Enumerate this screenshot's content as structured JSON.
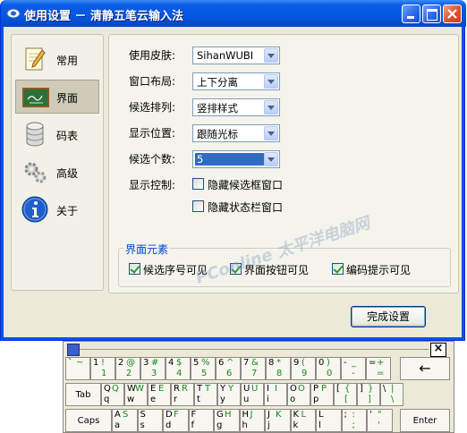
{
  "window": {
    "title": "使用设置 － 清静五笔云输入法"
  },
  "sidebar": {
    "items": [
      {
        "label": "常用",
        "icon": "notepad-pencil-icon"
      },
      {
        "label": "界面",
        "icon": "chalkboard-icon"
      },
      {
        "label": "码表",
        "icon": "database-icon"
      },
      {
        "label": "高级",
        "icon": "gears-icon"
      },
      {
        "label": "关于",
        "icon": "info-icon"
      }
    ],
    "active": "界面"
  },
  "form": {
    "skin_label": "使用皮肤:",
    "skin_value": "SihanWUBI",
    "layout_label": "窗口布局:",
    "layout_value": "上下分离",
    "order_label": "候选排列:",
    "order_value": "竖排样式",
    "position_label": "显示位置:",
    "position_value": "跟随光标",
    "count_label": "候选个数:",
    "count_value": "5",
    "display_label": "显示控制:",
    "hide_candidate_label": "隐藏候选框窗口",
    "hide_candidate_checked": false,
    "hide_status_label": "隐藏状态栏窗口",
    "hide_status_checked": false
  },
  "elements": {
    "group_title": "界面元素",
    "items": [
      {
        "label": "候选序号可见",
        "checked": true
      },
      {
        "label": "界面按钮可见",
        "checked": true
      },
      {
        "label": "编码提示可见",
        "checked": true
      }
    ]
  },
  "watermark": "PConline 太平洋电脑网",
  "ok_button": "完成设置",
  "keyboard": {
    "close": "×",
    "row1": [
      {
        "t": "`",
        "b": "",
        "s1": "~",
        "s2": ""
      },
      {
        "t": "1",
        "b": "",
        "s1": "!",
        "s2": "1"
      },
      {
        "t": "2",
        "b": "",
        "s1": "@",
        "s2": "2"
      },
      {
        "t": "3",
        "b": "",
        "s1": "#",
        "s2": "3"
      },
      {
        "t": "4",
        "b": "",
        "s1": "$",
        "s2": "4"
      },
      {
        "t": "5",
        "b": "",
        "s1": "%",
        "s2": "5"
      },
      {
        "t": "6",
        "b": "",
        "s1": "^",
        "s2": "6"
      },
      {
        "t": "7",
        "b": "",
        "s1": "&",
        "s2": "7"
      },
      {
        "t": "8",
        "b": "",
        "s1": "*",
        "s2": "8"
      },
      {
        "t": "9",
        "b": "",
        "s1": "(",
        "s2": "9"
      },
      {
        "t": "0",
        "b": "",
        "s1": ")",
        "s2": "0"
      },
      {
        "t": "-",
        "b": "",
        "s1": "_",
        "s2": "-"
      },
      {
        "t": "=",
        "b": "",
        "s1": "+",
        "s2": "="
      }
    ],
    "backspace": "←",
    "tab": "Tab",
    "row2": [
      {
        "t": "Q",
        "b": "q",
        "s1": "Q",
        "s2": ""
      },
      {
        "t": "W",
        "b": "w",
        "s1": "W",
        "s2": ""
      },
      {
        "t": "E",
        "b": "e",
        "s1": "E",
        "s2": ""
      },
      {
        "t": "R",
        "b": "r",
        "s1": "R",
        "s2": ""
      },
      {
        "t": "T",
        "b": "t",
        "s1": "T",
        "s2": ""
      },
      {
        "t": "Y",
        "b": "y",
        "s1": "Y",
        "s2": ""
      },
      {
        "t": "U",
        "b": "u",
        "s1": "U",
        "s2": ""
      },
      {
        "t": "I",
        "b": "i",
        "s1": "I",
        "s2": ""
      },
      {
        "t": "O",
        "b": "o",
        "s1": "O",
        "s2": ""
      },
      {
        "t": "P",
        "b": "p",
        "s1": "P",
        "s2": ""
      },
      {
        "t": "[",
        "b": "",
        "s1": "{",
        "s2": "["
      },
      {
        "t": "]",
        "b": "",
        "s1": "}",
        "s2": "]"
      },
      {
        "t": "\\",
        "b": "",
        "s1": "|",
        "s2": "\\"
      }
    ],
    "caps": "Caps",
    "row3": [
      {
        "t": "A",
        "b": "a",
        "s1": "S",
        "s2": ""
      },
      {
        "t": "S",
        "b": "s",
        "s1": "",
        "s2": ""
      },
      {
        "t": "D",
        "b": "d",
        "s1": "F",
        "s2": ""
      },
      {
        "t": "F",
        "b": "f",
        "s1": "",
        "s2": ""
      },
      {
        "t": "G",
        "b": "g",
        "s1": "H",
        "s2": ""
      },
      {
        "t": "H",
        "b": "h",
        "s1": "J",
        "s2": ""
      },
      {
        "t": "J",
        "b": "j",
        "s1": "K",
        "s2": ""
      },
      {
        "t": "K",
        "b": "k",
        "s1": "L",
        "s2": ""
      },
      {
        "t": "L",
        "b": "l",
        "s1": "",
        "s2": ""
      },
      {
        "t": ";",
        "b": "",
        "s1": ":",
        "s2": ";"
      },
      {
        "t": "'",
        "b": "",
        "s1": "\"",
        "s2": "'"
      }
    ],
    "enter": "Enter"
  }
}
